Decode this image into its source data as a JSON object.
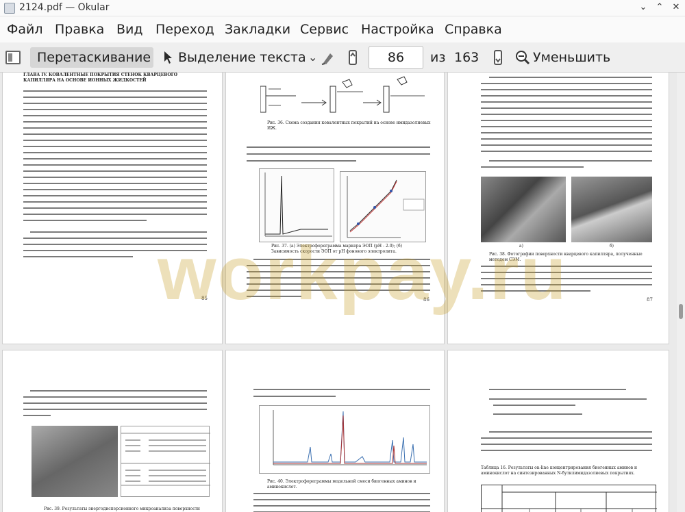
{
  "window": {
    "title": "2124.pdf — Okular",
    "minimize": "⌄",
    "maximize": "⌃",
    "close": "✕"
  },
  "menu": [
    "Файл",
    "Правка",
    "Вид",
    "Переход",
    "Закладки",
    "Сервис",
    "Настройка",
    "Справка"
  ],
  "toolbar": {
    "drag_mode": "Перетаскивание",
    "text_select": "Выделение текста",
    "current_page": "86",
    "of_label": "из",
    "total_pages": "163",
    "zoom_out": "Уменьшить"
  },
  "pages": {
    "p85": {
      "heading": "ГЛАВА IV. КОВАЛЕНТНЫЕ ПОКРЫТИЯ СТЕНОК КВАРЦЕВОГО КАПИЛЛЯРА НА ОСНОВЕ ИОННЫХ ЖИДКОСТЕЙ",
      "number": "85"
    },
    "p86": {
      "caption": "Рис. 36. Схема создания ковалентных покрытий на основе имидазолиевых ИЖ.",
      "caption2": "Рис. 37. (а) Электрофореграмма маркера ЭОП (рН - 2.0); (б) Зависимость скорости ЭОП от рН фонового электролита.",
      "number": "86"
    },
    "p87": {
      "label_a": "а)",
      "label_b": "б)",
      "caption": "Рис. 38. Фотографии поверхности кварцевого капилляра, полученные методом СЭМ.",
      "number": "87"
    },
    "p88": {
      "caption": "Рис. 39. Результаты энергодисперсионного микроанализа поверхности"
    },
    "p89": {
      "caption": "Рис. 40. Электрофореграммы модельной смеси биогенных аминов и аминокислот."
    },
    "p90": {
      "table_caption": "Таблица 16. Результаты on-line концентрирования биогенных аминов и аминокислот на синтезированных N-бутилимидазолиевых покрытиях."
    }
  },
  "watermark": "workpay.ru"
}
